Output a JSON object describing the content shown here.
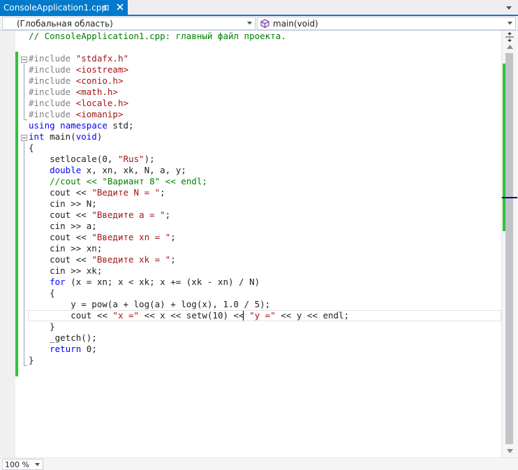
{
  "tab": {
    "title": "ConsoleApplication1.cpp",
    "icons": {
      "pin": "pin-icon",
      "close": "close-icon",
      "overflow": "chevron-down-icon"
    },
    "accent": "#007acc"
  },
  "navbar": {
    "scope": "(Глобальная область)",
    "function": "main(void)",
    "function_icon": "method-cube-icon"
  },
  "code": [
    [
      {
        "t": "// ConsoleApplication1.cpp: главный файл проекта.",
        "c": "cmt"
      }
    ],
    [],
    [
      {
        "t": "#include ",
        "c": "pre"
      },
      {
        "t": "\"stdafx.h\"",
        "c": "str"
      }
    ],
    [
      {
        "t": "#include ",
        "c": "pre"
      },
      {
        "t": "<iostream>",
        "c": "str"
      }
    ],
    [
      {
        "t": "#include ",
        "c": "pre"
      },
      {
        "t": "<conio.h>",
        "c": "str"
      }
    ],
    [
      {
        "t": "#include ",
        "c": "pre"
      },
      {
        "t": "<math.h>",
        "c": "str"
      }
    ],
    [
      {
        "t": "#include ",
        "c": "pre"
      },
      {
        "t": "<locale.h>",
        "c": "str"
      }
    ],
    [
      {
        "t": "#include ",
        "c": "pre"
      },
      {
        "t": "<iomanip>",
        "c": "str"
      }
    ],
    [
      {
        "t": "using",
        "c": "kw"
      },
      {
        "t": " ",
        "c": "plain"
      },
      {
        "t": "namespace",
        "c": "kw"
      },
      {
        "t": " std;",
        "c": "plain"
      }
    ],
    [
      {
        "t": "int",
        "c": "kw"
      },
      {
        "t": " main(",
        "c": "plain"
      },
      {
        "t": "void",
        "c": "kw"
      },
      {
        "t": ")",
        "c": "plain"
      }
    ],
    [
      {
        "t": "{",
        "c": "plain"
      }
    ],
    [
      {
        "t": "    setlocale(0, ",
        "c": "plain"
      },
      {
        "t": "\"Rus\"",
        "c": "str"
      },
      {
        "t": ");",
        "c": "plain"
      }
    ],
    [
      {
        "t": "    ",
        "c": "plain"
      },
      {
        "t": "double",
        "c": "kw"
      },
      {
        "t": " x, xn, xk, N, a, y;",
        "c": "plain"
      }
    ],
    [
      {
        "t": "    //cout << \"Вариант 8\" << endl;",
        "c": "cmt"
      }
    ],
    [
      {
        "t": "    cout << ",
        "c": "plain"
      },
      {
        "t": "\"Ведите N = \"",
        "c": "str"
      },
      {
        "t": ";",
        "c": "plain"
      }
    ],
    [
      {
        "t": "    cin >> N;",
        "c": "plain"
      }
    ],
    [
      {
        "t": "    cout << ",
        "c": "plain"
      },
      {
        "t": "\"Введите a = \"",
        "c": "str"
      },
      {
        "t": ";",
        "c": "plain"
      }
    ],
    [
      {
        "t": "    cin >> a;",
        "c": "plain"
      }
    ],
    [
      {
        "t": "    cout << ",
        "c": "plain"
      },
      {
        "t": "\"Введите xn = \"",
        "c": "str"
      },
      {
        "t": ";",
        "c": "plain"
      }
    ],
    [
      {
        "t": "    cin >> xn;",
        "c": "plain"
      }
    ],
    [
      {
        "t": "    cout << ",
        "c": "plain"
      },
      {
        "t": "\"Введите xk = \"",
        "c": "str"
      },
      {
        "t": ";",
        "c": "plain"
      }
    ],
    [
      {
        "t": "    cin >> xk;",
        "c": "plain"
      }
    ],
    [
      {
        "t": "    ",
        "c": "plain"
      },
      {
        "t": "for",
        "c": "kw"
      },
      {
        "t": " (x = xn; x < xk; x += (xk - xn) / N)",
        "c": "plain"
      }
    ],
    [
      {
        "t": "    {",
        "c": "plain"
      }
    ],
    [
      {
        "t": "        y = pow(a + log(a) + log(x), 1.0 / 5);",
        "c": "plain"
      }
    ],
    [
      {
        "t": "        cout << ",
        "c": "plain"
      },
      {
        "t": "\"x =\"",
        "c": "str"
      },
      {
        "t": " << x << setw(10) << ",
        "c": "plain"
      },
      {
        "t": "\"y =\"",
        "c": "str"
      },
      {
        "t": " << y << endl;",
        "c": "plain"
      }
    ],
    [
      {
        "t": "    }",
        "c": "plain"
      }
    ],
    [
      {
        "t": "    _getch();",
        "c": "plain"
      }
    ],
    [
      {
        "t": "    ",
        "c": "plain"
      },
      {
        "t": "return",
        "c": "kw"
      },
      {
        "t": " 0;",
        "c": "plain"
      }
    ],
    [
      {
        "t": "}",
        "c": "plain"
      }
    ]
  ],
  "syntax_colors": {
    "keyword": "#0000ff",
    "string": "#a31515",
    "comment": "#008000",
    "preprocessor": "#808080",
    "changed_lines": "#2fc43b"
  },
  "zoom": "100 %"
}
